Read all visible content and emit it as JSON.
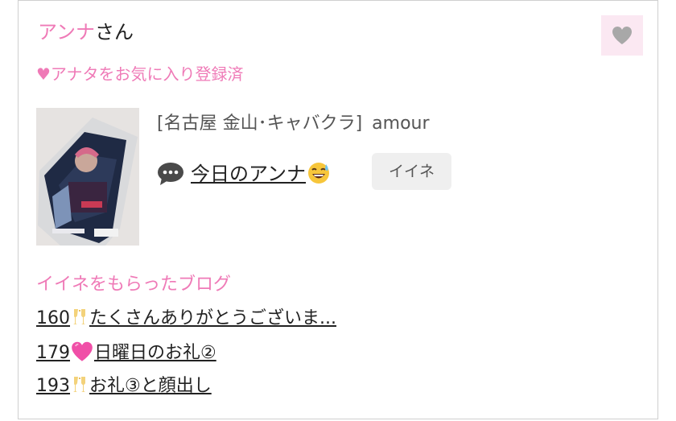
{
  "profile": {
    "name": "アンナ",
    "honorific": "さん",
    "favorite_status": "♥アナタをお気に入り登録済",
    "shop": {
      "area_genre": "[名古屋 金山･キャバクラ]",
      "name": "amour"
    },
    "latest_blog": {
      "icon": "speech-bubble-icon",
      "title": "今日のアンナ",
      "emoji": "sweat-smile-emoji"
    },
    "like_button_label": "イイネ",
    "favorite_icon": "heart-icon"
  },
  "liked_blogs": {
    "title": "イイネをもらったブログ",
    "items": [
      {
        "count": "160",
        "icon": "champagne-glasses-icon",
        "title": "たくさんありがとうございま..."
      },
      {
        "count": "179",
        "icon": "pink-heart-icon",
        "title": "日曜日のお礼②"
      },
      {
        "count": "193",
        "icon": "champagne-glasses-icon",
        "title": "お礼③と顔出し"
      }
    ]
  },
  "colors": {
    "accent_pink": "#ef7ab7",
    "fav_bg": "#fbe8f2",
    "button_bg": "#efefef"
  }
}
